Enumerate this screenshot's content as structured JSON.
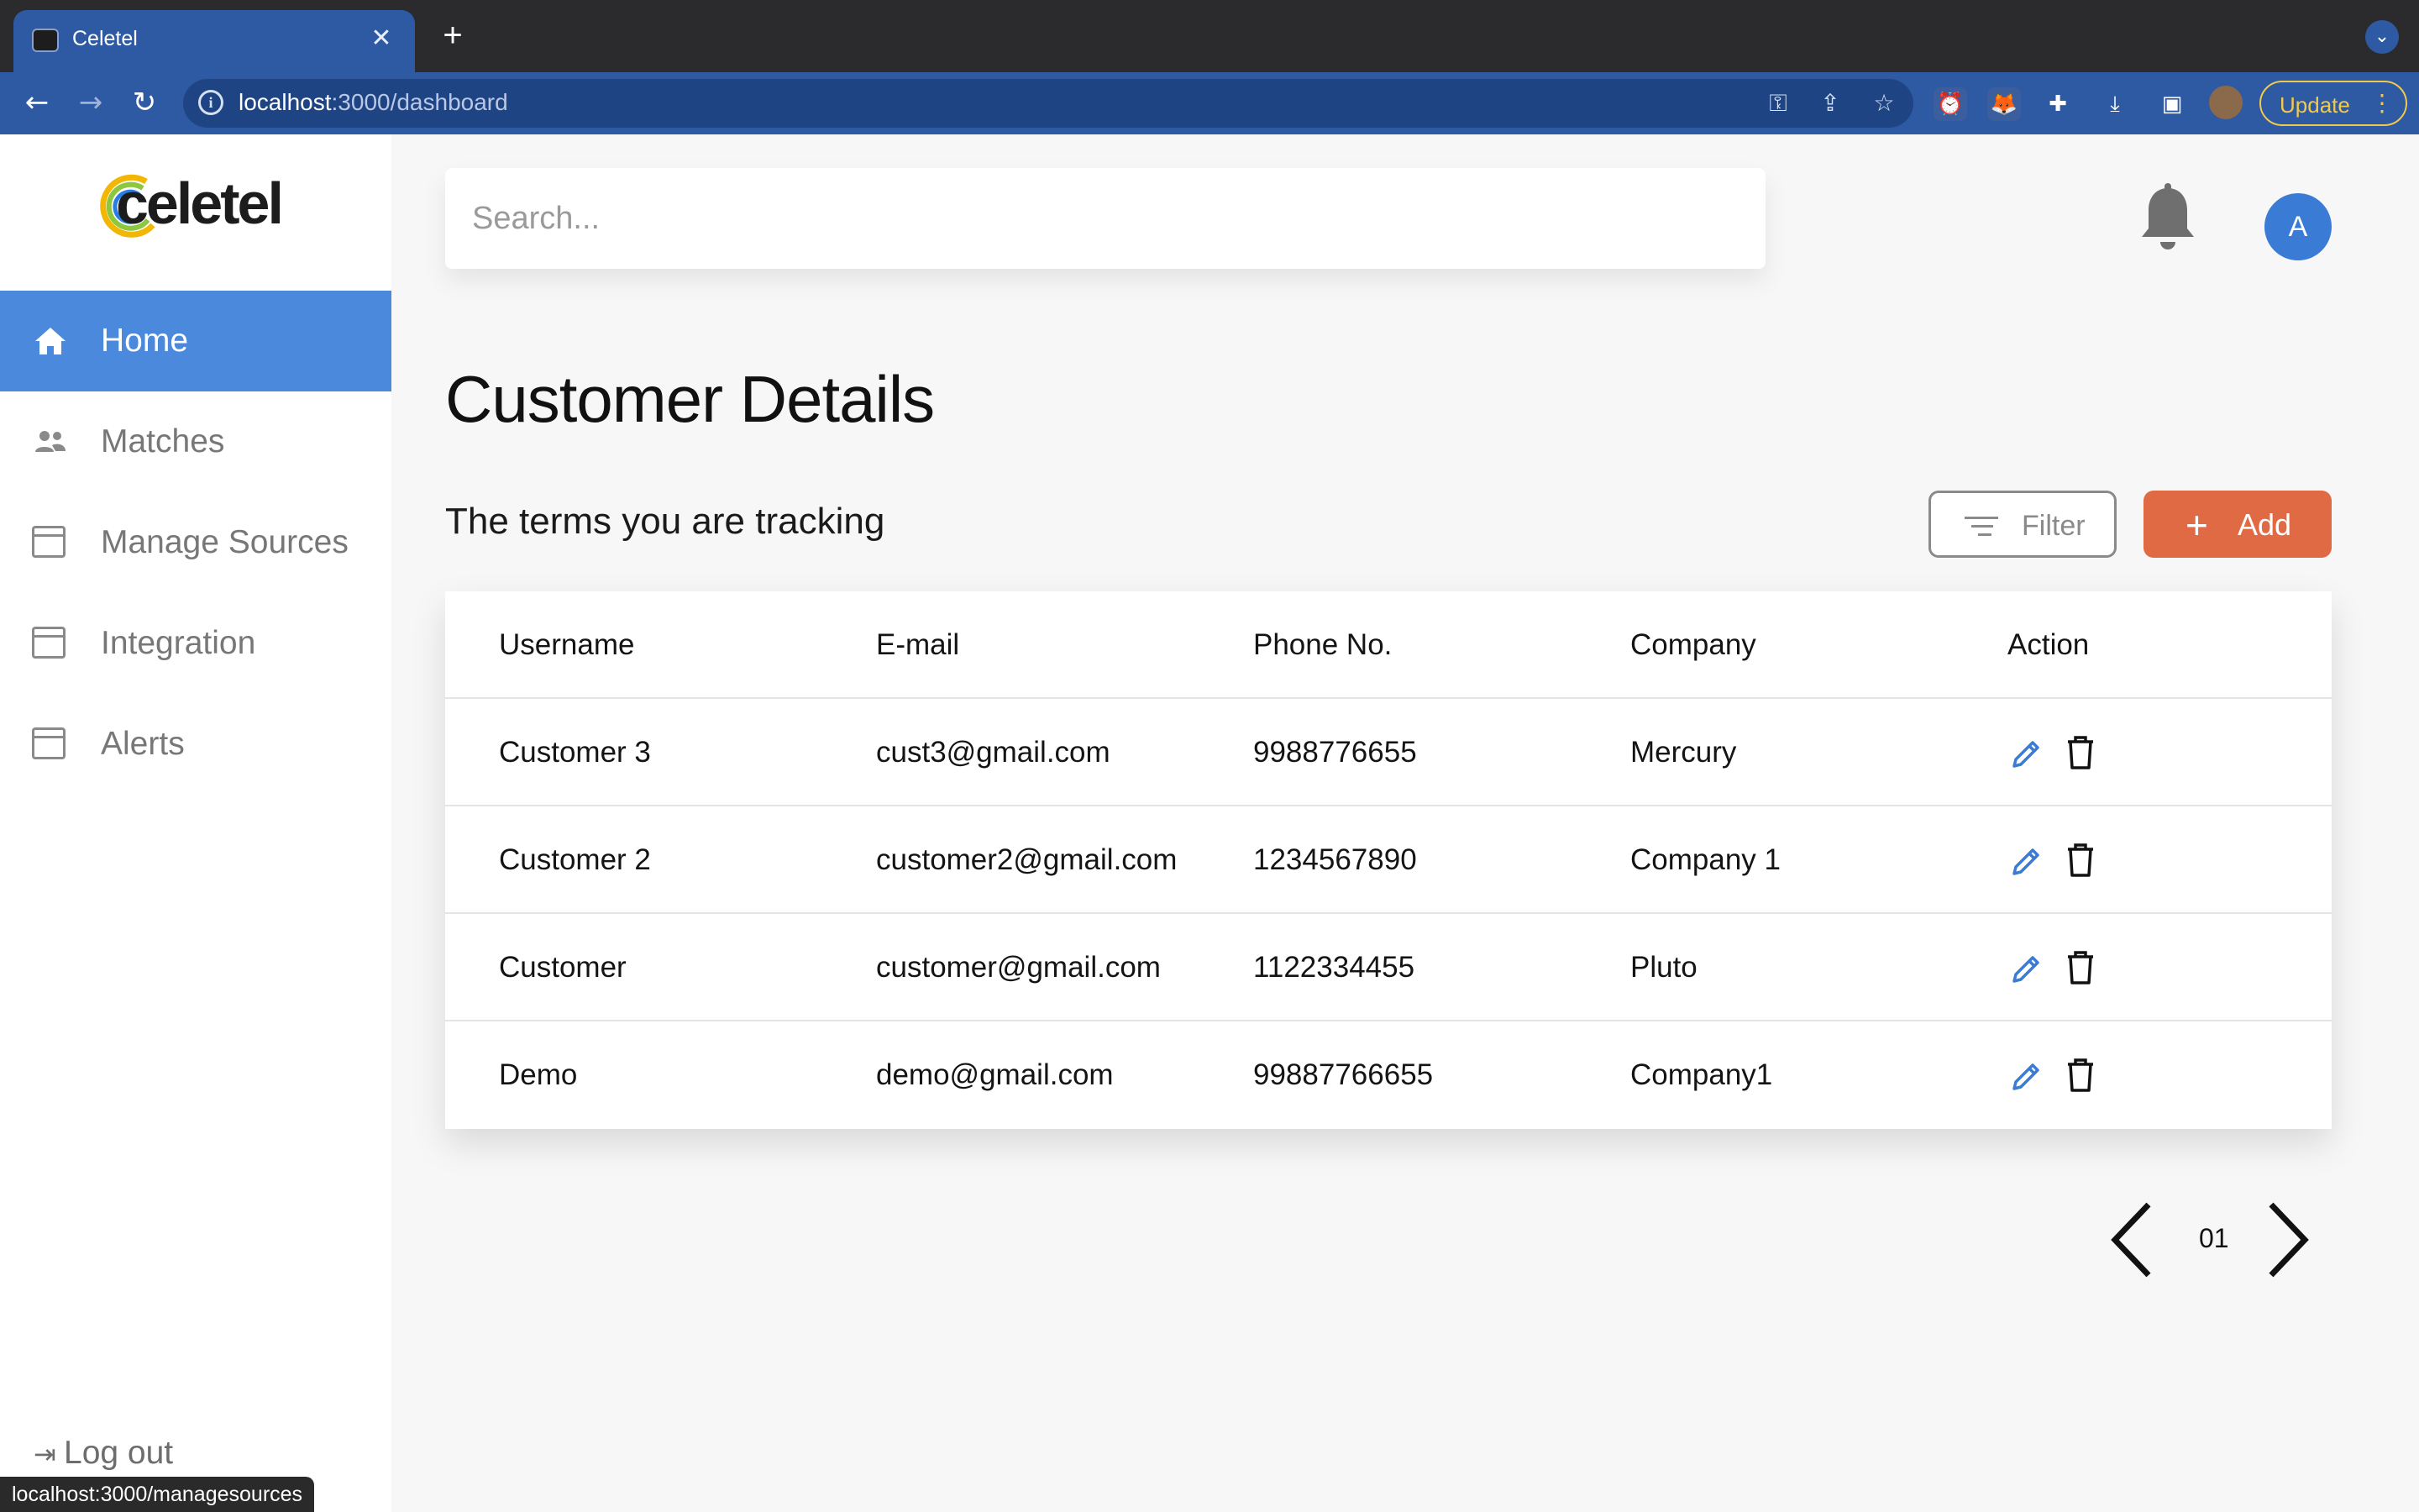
{
  "browser": {
    "tab_title": "Celetel",
    "tab_close": "✕",
    "new_tab": "+",
    "url_host": "localhost",
    "url_rest": ":3000/dashboard",
    "update_label": "Update",
    "status_url": "localhost:3000/managesources"
  },
  "sidebar": {
    "logo": "celetel",
    "items": [
      {
        "label": "Home",
        "icon": "home-icon",
        "active": true
      },
      {
        "label": "Matches",
        "icon": "people-icon",
        "active": false
      },
      {
        "label": "Manage Sources",
        "icon": "calendar-icon",
        "active": false
      },
      {
        "label": "Integration",
        "icon": "calendar-icon",
        "active": false
      },
      {
        "label": "Alerts",
        "icon": "calendar-icon",
        "active": false
      }
    ],
    "logout_label": "Log out"
  },
  "header": {
    "search_placeholder": "Search...",
    "avatar_initial": "A"
  },
  "main": {
    "title": "Customer Details",
    "subtitle": "The terms you are tracking",
    "filter_label": "Filter",
    "add_plus": "+",
    "add_label": "Add"
  },
  "table": {
    "columns": [
      "Username",
      "E-mail",
      "Phone No.",
      "Company",
      "Action"
    ],
    "rows": [
      {
        "username": "Customer 3",
        "email": "cust3@gmail.com",
        "phone": "9988776655",
        "company": "Mercury"
      },
      {
        "username": "Customer 2",
        "email": "customer2@gmail.com",
        "phone": "1234567890",
        "company": "Company 1"
      },
      {
        "username": "Customer",
        "email": "customer@gmail.com",
        "phone": "1122334455",
        "company": "Pluto"
      },
      {
        "username": "Demo",
        "email": "demo@gmail.com",
        "phone": "99887766655",
        "company": "Company1"
      }
    ]
  },
  "pagination": {
    "page": "01"
  },
  "colors": {
    "accent_blue": "#4a89dc",
    "add_orange": "#e06a43",
    "edit_blue": "#3a7bd5",
    "browser_blue": "#2e5aa3"
  }
}
